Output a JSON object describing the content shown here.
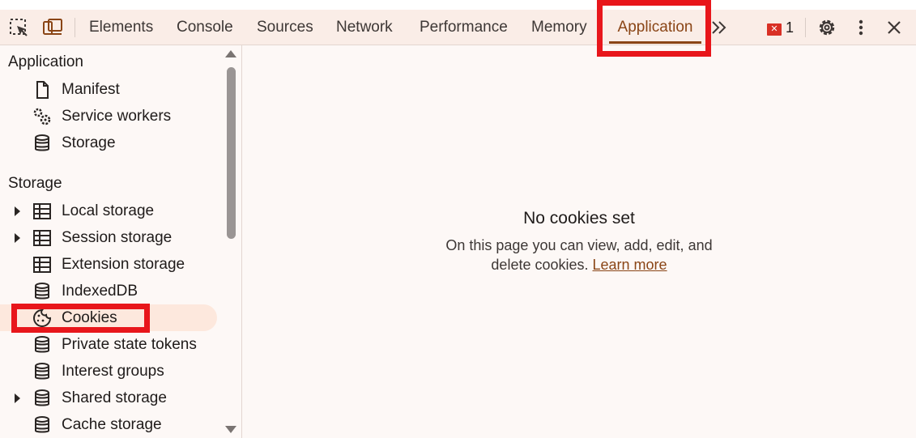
{
  "toolbar": {
    "icons": {
      "inspect": "inspect-element-icon",
      "device": "device-toolbar-icon",
      "more_tabs": "chevron-double-right-icon",
      "settings": "gear-icon",
      "menu": "kebab-menu-icon",
      "close": "close-icon"
    },
    "tabs": [
      {
        "label": "Elements"
      },
      {
        "label": "Console"
      },
      {
        "label": "Sources"
      },
      {
        "label": "Network"
      },
      {
        "label": "Performance"
      },
      {
        "label": "Memory"
      },
      {
        "label": "Application",
        "active": true
      }
    ],
    "issues_count": "1"
  },
  "sidebar": {
    "application_section": {
      "title": "Application",
      "items": [
        {
          "label": "Manifest",
          "icon": "document-icon"
        },
        {
          "label": "Service workers",
          "icon": "gears-icon"
        },
        {
          "label": "Storage",
          "icon": "database-icon"
        }
      ]
    },
    "storage_section": {
      "title": "Storage",
      "items": [
        {
          "label": "Local storage",
          "icon": "table-icon",
          "expandable": true
        },
        {
          "label": "Session storage",
          "icon": "table-icon",
          "expandable": true
        },
        {
          "label": "Extension storage",
          "icon": "table-icon",
          "expandable": false
        },
        {
          "label": "IndexedDB",
          "icon": "database-icon",
          "expandable": false
        },
        {
          "label": "Cookies",
          "icon": "cookie-icon",
          "expandable": false,
          "selected": true
        },
        {
          "label": "Private state tokens",
          "icon": "database-icon",
          "expandable": false
        },
        {
          "label": "Interest groups",
          "icon": "database-icon",
          "expandable": false
        },
        {
          "label": "Shared storage",
          "icon": "database-icon",
          "expandable": true
        },
        {
          "label": "Cache storage",
          "icon": "database-icon",
          "expandable": false
        }
      ]
    }
  },
  "main": {
    "empty_title": "No cookies set",
    "empty_description": "On this page you can view, add, edit, and delete cookies.",
    "learn_more": "Learn more"
  },
  "colors": {
    "accent": "#8a4516",
    "highlight": "#e8161b",
    "toolbar_bg": "#faede7",
    "selected_bg": "#fde8dd",
    "error": "#d93025"
  }
}
